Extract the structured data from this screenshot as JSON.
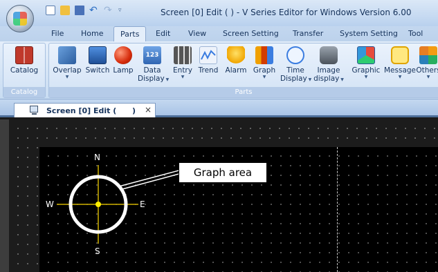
{
  "window": {
    "title": "Screen [0] Edit (          ) - V Series Editor for Windows Version 6.00"
  },
  "ribbon_tabs": [
    "File",
    "Home",
    "Parts",
    "Edit",
    "View",
    "Screen Setting",
    "Transfer",
    "System Setting",
    "Tool"
  ],
  "active_tab": "Parts",
  "catalog_group": {
    "label": "Catalog",
    "button": "Catalog"
  },
  "parts_group": {
    "label": "Parts",
    "buttons": [
      {
        "line1": "Overlap",
        "line2": ""
      },
      {
        "line1": "Switch",
        "line2": ""
      },
      {
        "line1": "Lamp",
        "line2": ""
      },
      {
        "line1": "Data",
        "line2": "Display"
      },
      {
        "line1": "Entry",
        "line2": ""
      },
      {
        "line1": "Trend",
        "line2": ""
      },
      {
        "line1": "Alarm",
        "line2": ""
      },
      {
        "line1": "Graph",
        "line2": ""
      },
      {
        "line1": "Time",
        "line2": "Display"
      },
      {
        "line1": "Image",
        "line2": "display"
      },
      {
        "line1": "Graphic",
        "line2": ""
      },
      {
        "line1": "Message",
        "line2": ""
      },
      {
        "line1": "Others",
        "line2": ""
      }
    ],
    "data_display_icon_text": "123"
  },
  "document_tab": {
    "label": "Screen [0] Edit (",
    "paren_close": ")",
    "close": "×"
  },
  "compass": {
    "north": "N",
    "south": "S",
    "east": "E",
    "west": "W"
  },
  "callout": "Graph area",
  "colors": {
    "ribbon_bg": "#dbe8f7",
    "canvas_bg": "#000000",
    "crosshair": "#d4b800",
    "center_dot": "#ffee00",
    "ring": "#ffffff"
  }
}
